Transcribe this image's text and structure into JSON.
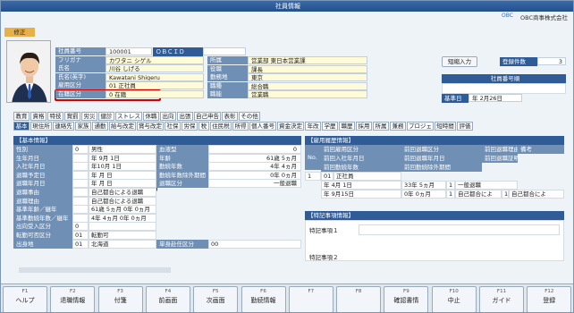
{
  "window": {
    "title": "社員情報",
    "company": "OBC商事株式会社",
    "logo_text": "OBC",
    "mode": "修正"
  },
  "employee": {
    "fields": [
      {
        "label": "社員番号",
        "value": "100001"
      },
      {
        "label": "フリガナ",
        "value": "カワタニ シゲル"
      },
      {
        "label": "氏名",
        "value": "川谷 しげる"
      },
      {
        "label": "氏名(英字)",
        "value": "Kawatani Shigeru"
      },
      {
        "label": "雇用区分",
        "value": "01 正社員"
      },
      {
        "label": "在籍区分",
        "value": "0 在籍"
      }
    ],
    "obcid_label": "ＯＢＣＩＤ",
    "right": [
      {
        "label": "所属",
        "value": "営業部 東日本営業課"
      },
      {
        "label": "役職",
        "value": "課長"
      },
      {
        "label": "勤務地",
        "value": "東京"
      },
      {
        "label": "職種",
        "value": "総合職"
      },
      {
        "label": "職能",
        "value": "営業職"
      }
    ],
    "short_input": "短縮入力",
    "reg_count_label": "登録件数",
    "reg_count": "3",
    "employee_no_hdr": "社員番号順",
    "base_date_label": "基準日",
    "base_date": "年 2月26日"
  },
  "tabs_row1": [
    "教育",
    "資格",
    "特技",
    "賞罰",
    "労災",
    "健診",
    "ストレス",
    "休職",
    "出向",
    "出張",
    "自己申告",
    "表彰",
    "その他"
  ],
  "tabs_row2": [
    "基本",
    "現住所",
    "連絡先",
    "家族",
    "通勤",
    "給与改定",
    "賞与改定",
    "社保",
    "労保",
    "税",
    "住民税",
    "所得",
    "個人番号",
    "資金決定",
    "年改",
    "学歴",
    "職歴",
    "採用",
    "所属",
    "兼務",
    "プロジェ",
    "短時間",
    "評価"
  ],
  "basic": {
    "title": "【基本情報】",
    "rows": [
      {
        "label": "性別",
        "code": "0",
        "text": "男性"
      },
      {
        "label": "生年月日",
        "code": "",
        "text": "年 9月 1日"
      },
      {
        "label": "入社年月日",
        "code": "",
        "text": "年10月 1日"
      },
      {
        "label": "退職予定日",
        "code": "",
        "text": "年 月 日"
      },
      {
        "label": "退職年月日",
        "code": "",
        "text": "年 月 日"
      },
      {
        "label": "退職事由",
        "code": "",
        "text": "自己都合による退職"
      },
      {
        "label": "退職理由",
        "code": "",
        "text": "自己都合による退職"
      },
      {
        "label": "基準年齢／継年",
        "code": "",
        "text": "61歳 5ヵ月 0年 0ヵ月"
      },
      {
        "label": "基準勤続年数／継年",
        "code": "",
        "text": "4年 4ヵ月 0年 0ヵ月"
      },
      {
        "label": "出向受入区分",
        "code": "0",
        "text": ""
      },
      {
        "label": "転勤可否区分",
        "code": "01",
        "text": "転勤可"
      },
      {
        "label": "出身地",
        "code": "01",
        "text": "北海道"
      }
    ],
    "right": [
      {
        "label": "血液型",
        "value": "0"
      },
      {
        "label": "年齢",
        "value": "61歳 5ヵ月"
      },
      {
        "label": "勤続年数",
        "value": "4年 4ヵ月"
      },
      {
        "label": "勤続年数除外期間",
        "value": "0年 0ヵ月"
      },
      {
        "label": "退職区分",
        "value": "一般退職"
      }
    ],
    "tanshin_label": "単身赴任区分",
    "tanshin_value": "00"
  },
  "history": {
    "title": "【雇用履歴情報】",
    "headers": [
      "No.",
      "前回雇用区分",
      "前回入社年月日",
      "前回勤続年数",
      "前回退職区分",
      "前回退職年月日",
      "前回勤続除外期間",
      "前回退職理由",
      "前回退職証明書事由",
      "備考"
    ],
    "row": {
      "no": "1",
      "code": "01",
      "type": "正社員",
      "hire": "年 4月 1日",
      "years": "33年 5ヵ月",
      "retire_code": "1",
      "retire": "一般退職",
      "retire_date": "年 9月15日",
      "excl": "0年 0ヵ月",
      "reason_code": "1",
      "reason": "自己都合によ",
      "cert_code": "1",
      "cert": "自己都合によ"
    }
  },
  "special": {
    "title": "【特記事項情報】",
    "items": [
      "特記事項１",
      "特記事項２"
    ]
  },
  "fkeys": [
    {
      "key": "F1",
      "label": "ヘルプ"
    },
    {
      "key": "F2",
      "label": "退職情報"
    },
    {
      "key": "F3",
      "label": "付箋"
    },
    {
      "key": "F4",
      "label": "前画面"
    },
    {
      "key": "F5",
      "label": "次画面"
    },
    {
      "key": "F6",
      "label": "勤続情報"
    },
    {
      "key": "F7",
      "label": ""
    },
    {
      "key": "F8",
      "label": ""
    },
    {
      "key": "F9",
      "label": "確認書情"
    },
    {
      "key": "F10",
      "label": "中止"
    },
    {
      "key": "F11",
      "label": "ガイド"
    },
    {
      "key": "F12",
      "label": "登録"
    }
  ],
  "colors": {
    "accent": "#2f5c96",
    "highlight": "#d40000"
  }
}
